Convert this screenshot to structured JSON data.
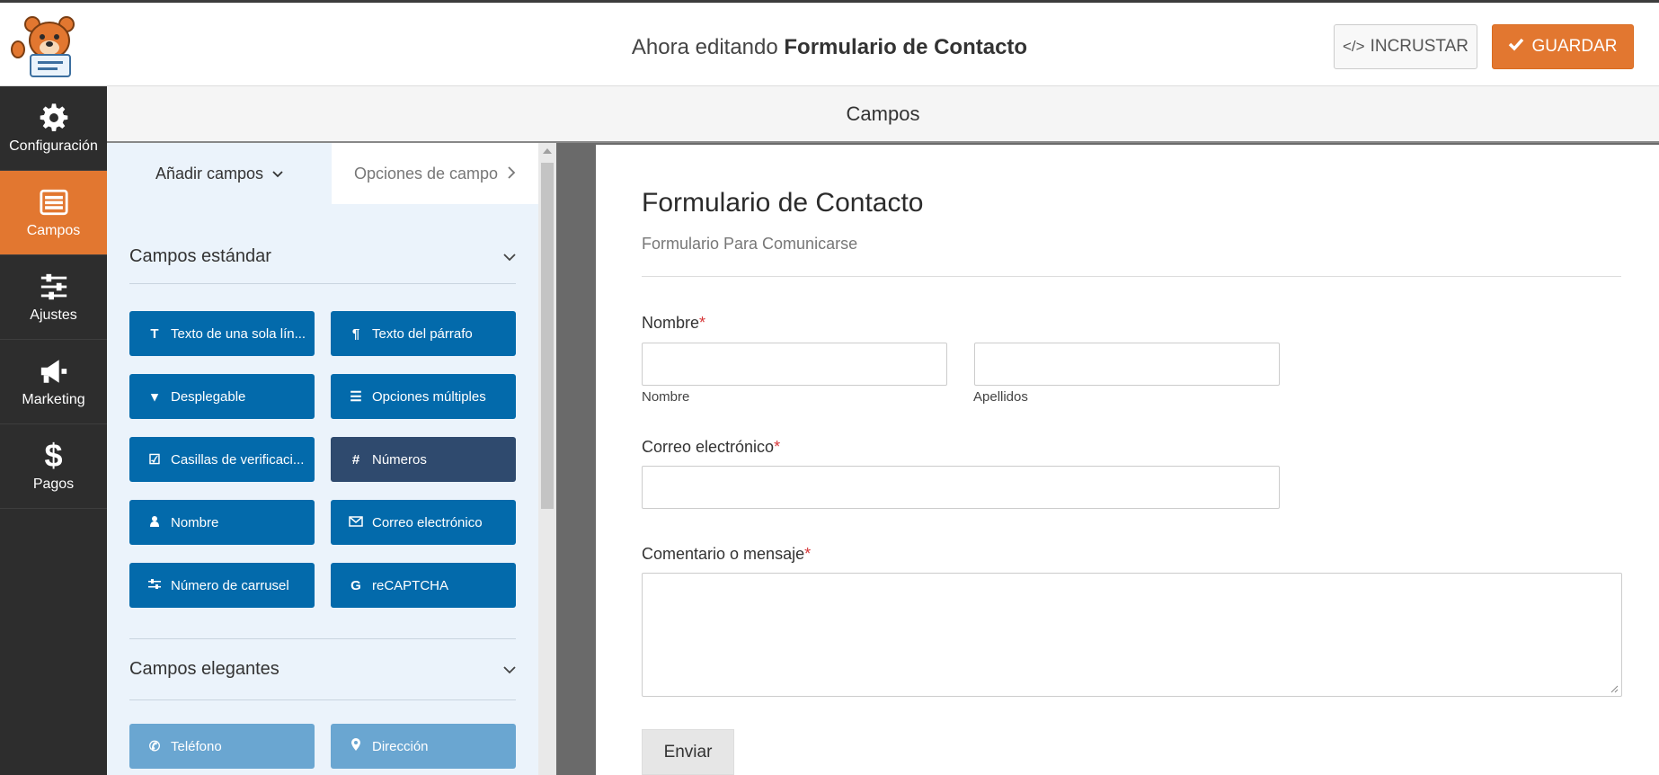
{
  "header": {
    "title_prefix": "Ahora editando",
    "title_form": "Formulario de Contacto",
    "embed_label": "INCRUSTAR",
    "save_label": "GUARDAR"
  },
  "nav": {
    "items": [
      {
        "label": "Configuración",
        "icon": "gear-icon",
        "active": false
      },
      {
        "label": "Campos",
        "icon": "fields-icon",
        "active": true
      },
      {
        "label": "Ajustes",
        "icon": "sliders-icon",
        "active": false
      },
      {
        "label": "Marketing",
        "icon": "megaphone-icon",
        "active": false
      },
      {
        "label": "Pagos",
        "icon": "dollar-icon",
        "active": false
      }
    ]
  },
  "section_title": "Campos",
  "panel": {
    "tabs": [
      {
        "label": "Añadir campos"
      },
      {
        "label": "Opciones de campo"
      }
    ],
    "standard": {
      "heading": "Campos estándar",
      "buttons": [
        {
          "label": "Texto de una sola lín...",
          "icon": "text-icon"
        },
        {
          "label": "Texto del párrafo",
          "icon": "paragraph-icon"
        },
        {
          "label": "Desplegable",
          "icon": "dropdown-icon"
        },
        {
          "label": "Opciones múltiples",
          "icon": "list-icon"
        },
        {
          "label": "Casillas de verificaci...",
          "icon": "checkbox-icon"
        },
        {
          "label": "Números",
          "icon": "hash-icon"
        },
        {
          "label": "Nombre",
          "icon": "user-icon"
        },
        {
          "label": "Correo electrónico",
          "icon": "envelope-icon"
        },
        {
          "label": "Número de carrusel",
          "icon": "sliders-icon"
        },
        {
          "label": "reCAPTCHA",
          "icon": "google-icon"
        }
      ]
    },
    "fancy": {
      "heading": "Campos elegantes",
      "buttons": [
        {
          "label": "Teléfono",
          "icon": "phone-icon"
        },
        {
          "label": "Dirección",
          "icon": "map-marker-icon"
        }
      ]
    }
  },
  "form": {
    "title": "Formulario de Contacto",
    "description": "Formulario Para Comunicarse",
    "required_mark": "*",
    "name_label": "Nombre",
    "first_sublabel": "Nombre",
    "last_sublabel": "Apellidos",
    "email_label": "Correo electrónico",
    "comment_label": "Comentario o mensaje",
    "submit_label": "Enviar"
  },
  "colors": {
    "accent": "#e27730",
    "field_button": "#036aab",
    "field_button_selected": "#2f4a6e",
    "field_button_fancy": "#6aa6d1",
    "nav_bg": "#2d2d2d",
    "required": "#d63638"
  }
}
